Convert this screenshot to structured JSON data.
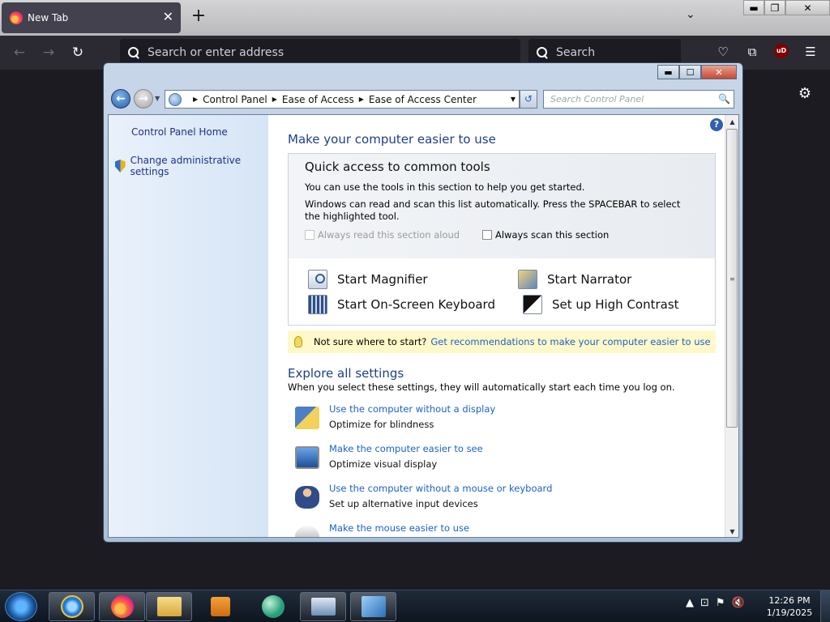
{
  "browser": {
    "tab_title": "New Tab",
    "tab_close": "✕",
    "new_tab": "+",
    "list_all_tabs": "⌄",
    "address_placeholder": "Search or enter address",
    "search_placeholder": "Search",
    "nav": {
      "back": "←",
      "forward": "→",
      "reload": "↻"
    },
    "toolbar": {
      "pocket": "♡",
      "extensions": "⧉",
      "ublock": "uD",
      "menu": "☰",
      "settings": "⚙"
    },
    "window_buttons": {
      "minimize": "▬",
      "maximize": "❐",
      "close": "✕"
    }
  },
  "cp_window": {
    "caption_buttons": {
      "minimize": "▬",
      "maximize": "☐",
      "close": "✕"
    },
    "breadcrumb": [
      "Control Panel",
      "Ease of Access",
      "Ease of Access Center"
    ],
    "breadcrumb_sep": "▶",
    "address_dropdown": "▼",
    "refresh": "↺",
    "search_placeholder": "Search Control Panel",
    "search_icon": "🔍",
    "help": "?",
    "left_pane": {
      "home": "Control Panel Home",
      "admin": "Change administrative settings"
    },
    "main": {
      "title": "Make your computer easier to use",
      "quick": {
        "title": "Quick access to common tools",
        "line1": "You can use the tools in this section to help you get started.",
        "line2": "Windows can read and scan this list automatically.  Press the SPACEBAR to select the highlighted tool.",
        "read_aloud": "Always read this section aloud",
        "scan": "Always scan this section"
      },
      "tools": {
        "magnifier": "Start Magnifier",
        "narrator": "Start Narrator",
        "keyboard": "Start On-Screen Keyboard",
        "contrast": "Set up High Contrast"
      },
      "tip": {
        "text": "Not sure where to start?",
        "link": "Get recommendations to make your computer easier to use"
      },
      "explore": {
        "title": "Explore all settings",
        "subtitle": "When you select these settings, they will automatically start each time you log on."
      },
      "settings": [
        {
          "link": "Use the computer without a display",
          "desc": "Optimize for blindness"
        },
        {
          "link": "Make the computer easier to see",
          "desc": "Optimize visual display"
        },
        {
          "link": "Use the computer without a mouse or keyboard",
          "desc": "Set up alternative input devices"
        },
        {
          "link": "Make the mouse easier to use",
          "desc": ""
        }
      ]
    },
    "scrollbar": {
      "up": "▲",
      "down": "▼",
      "grip": "≡"
    }
  },
  "taskbar": {
    "tray_icons": [
      "▲",
      "⊡",
      "⚑",
      "🔇"
    ],
    "time": "12:26 PM",
    "date": "1/19/2025"
  }
}
